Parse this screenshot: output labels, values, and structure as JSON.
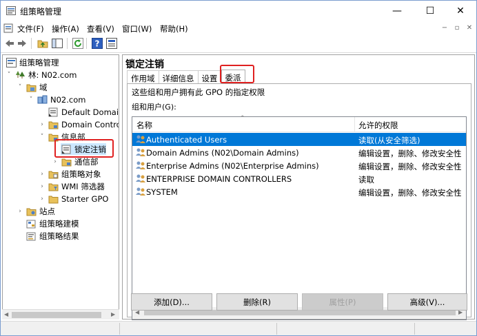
{
  "window": {
    "title": "组策略管理",
    "controls": {
      "minimize": "—",
      "maximize": "☐",
      "close": "✕"
    }
  },
  "menubar": {
    "items": [
      "文件(F)",
      "操作(A)",
      "查看(V)",
      "窗口(W)",
      "帮助(H)"
    ],
    "mdi_controls": [
      "−",
      "▫",
      "✕"
    ]
  },
  "toolbar": {
    "icons": [
      "back-arrow-icon",
      "forward-arrow-icon",
      "up-folder-icon",
      "show-tree-icon",
      "refresh-icon",
      "help-icon",
      "properties-icon"
    ]
  },
  "tree": {
    "nodes": [
      {
        "label": "组策略管理",
        "arrow": "",
        "icon": "gpm-icon"
      },
      {
        "label": "林: N02.com",
        "arrow": "˅",
        "icon": "forest-icon"
      },
      {
        "label": "域",
        "arrow": "˅",
        "icon": "domains-icon"
      },
      {
        "label": "N02.com",
        "arrow": "˅",
        "icon": "domain-icon"
      },
      {
        "label": "Default Domai",
        "arrow": "",
        "icon": "gpo-link-icon"
      },
      {
        "label": "Domain Contro",
        "arrow": "›",
        "icon": "ou-folder-icon"
      },
      {
        "label": "信息部",
        "arrow": "˅",
        "icon": "ou-folder-icon"
      },
      {
        "label": "锁定注销",
        "arrow": "",
        "icon": "gpo-link-icon"
      },
      {
        "label": "通信部",
        "arrow": "›",
        "icon": "ou-folder-icon"
      },
      {
        "label": "组策略对象",
        "arrow": "›",
        "icon": "gpo-folder-icon"
      },
      {
        "label": "WMI 筛选器",
        "arrow": "›",
        "icon": "wmi-folder-icon"
      },
      {
        "label": "Starter GPO",
        "arrow": "›",
        "icon": "starter-folder-icon"
      },
      {
        "label": "站点",
        "arrow": "›",
        "icon": "sites-icon"
      },
      {
        "label": "组策略建模",
        "arrow": "",
        "icon": "modeling-icon"
      },
      {
        "label": "组策略结果",
        "arrow": "",
        "icon": "results-icon"
      }
    ]
  },
  "panel": {
    "title": "锁定注销",
    "tabs": [
      "作用域",
      "详细信息",
      "设置",
      "委派"
    ],
    "active_tab": "委派",
    "description": "这些组和用户拥有此 GPO 的指定权限",
    "group_label": "组和用户(G):",
    "columns": [
      "名称",
      "允许的权限"
    ],
    "rows": [
      {
        "name": "Authenticated Users",
        "permission": "读取(从安全筛选)",
        "selected": true
      },
      {
        "name": "Domain Admins (N02\\Domain Admins)",
        "permission": "编辑设置，删除、修改安全性",
        "selected": false
      },
      {
        "name": "Enterprise Admins (N02\\Enterprise Admins)",
        "permission": "编辑设置，删除、修改安全性",
        "selected": false
      },
      {
        "name": "ENTERPRISE DOMAIN CONTROLLERS",
        "permission": "读取",
        "selected": false
      },
      {
        "name": "SYSTEM",
        "permission": "编辑设置，删除、修改安全性",
        "selected": false
      }
    ],
    "buttons": {
      "add": "添加(D)...",
      "remove": "删除(R)",
      "properties": "属性(P)",
      "advanced": "高级(V)..."
    }
  },
  "colors": {
    "selection": "#0078d7",
    "highlight_box": "#e02020"
  }
}
